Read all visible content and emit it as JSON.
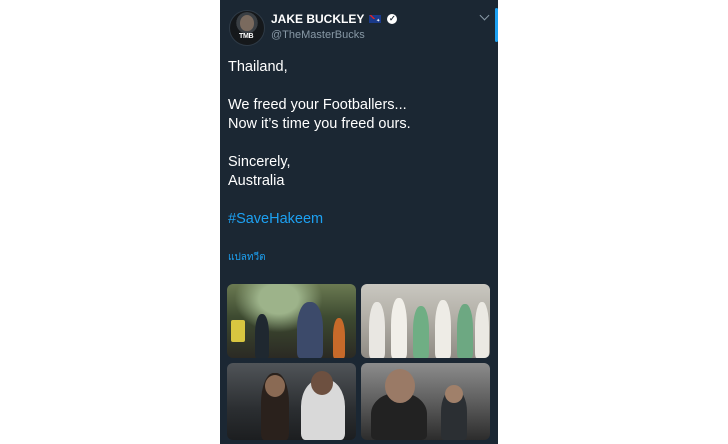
{
  "author": {
    "name": "JAKE BUCKLEY",
    "handle": "@TheMasterBucks",
    "avatar_text": "TMB",
    "badge_icons": [
      "australia-flag-icon",
      "verified-icon"
    ]
  },
  "tweet": {
    "line1": "Thailand,",
    "line2": "We freed your Footballers...",
    "line3": "Now it’s time you freed ours.",
    "line4": "Sincerely,",
    "line5": "Australia",
    "hashtag": "#SaveHakeem"
  },
  "translate_label": "แปลทวีต",
  "colors": {
    "background": "#1b2733",
    "text": "#ffffff",
    "accent": "#1da1f2",
    "secondary": "#8899a6"
  },
  "media": [
    {
      "description_icon": "photo-cave-rescue"
    },
    {
      "description_icon": "photo-football-team"
    },
    {
      "description_icon": "photo-hakeem-escorted"
    },
    {
      "description_icon": "photo-hakeem-portrait"
    }
  ]
}
